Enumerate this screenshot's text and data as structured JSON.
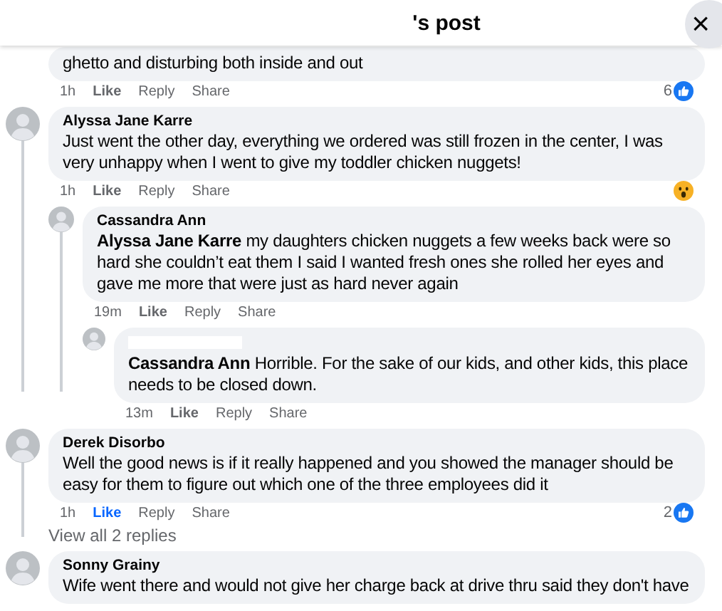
{
  "header": {
    "title": "'s post",
    "close": "×"
  },
  "comments": [
    {
      "text": "ghetto and disturbing both inside and out",
      "time": "1h",
      "actions": [
        {
          "label": "Like",
          "selected": false
        },
        {
          "label": "Reply",
          "selected": false
        },
        {
          "label": "Share",
          "selected": false
        }
      ],
      "reaction": {
        "kind": "like",
        "count": "6"
      }
    },
    {
      "author": "Alyssa Jane Karre",
      "text": "Just went the other day, everything we ordered was still frozen in the center, I was very unhappy when I went to give my toddler chicken nuggets!",
      "time": "1h",
      "actions": [
        {
          "label": "Like",
          "selected": false
        },
        {
          "label": "Reply",
          "selected": false
        },
        {
          "label": "Share",
          "selected": false
        }
      ],
      "reaction": {
        "kind": "wow"
      },
      "children": [
        {
          "author": "Cassandra Ann",
          "text": "**Alyssa Jane Karre** my daughters chicken nuggets a few weeks back were so hard she couldn’t eat them I said I wanted fresh ones she rolled her eyes and gave me more that were just as hard never again",
          "time": "19m",
          "actions": [
            {
              "label": "Like",
              "selected": false
            },
            {
              "label": "Reply",
              "selected": false
            },
            {
              "label": "Share",
              "selected": false
            }
          ],
          "children": [
            {
              "name_hidden": true,
              "text": "**Cassandra Ann** Horrible. For the sake of our kids, and other kids, this place needs to be closed down.",
              "time": "13m",
              "actions": [
                {
                  "label": "Like",
                  "selected": false
                },
                {
                  "label": "Reply",
                  "selected": false
                },
                {
                  "label": "Share",
                  "selected": false
                }
              ]
            }
          ]
        }
      ]
    },
    {
      "author": "Derek Disorbo",
      "text": "Well the good news is if it really happened and you showed the manager should be easy for them to figure out which one of the three employees did it",
      "time": "1h",
      "actions": [
        {
          "label": "Like",
          "selected": true
        },
        {
          "label": "Reply",
          "selected": false
        },
        {
          "label": "Share",
          "selected": false
        }
      ],
      "reaction": {
        "kind": "like",
        "count": "2"
      },
      "more_replies": "View all 2 replies"
    },
    {
      "author": "Sonny Grainy",
      "text": "Wife went there and would not give her charge back at drive thru said they don't have"
    }
  ]
}
